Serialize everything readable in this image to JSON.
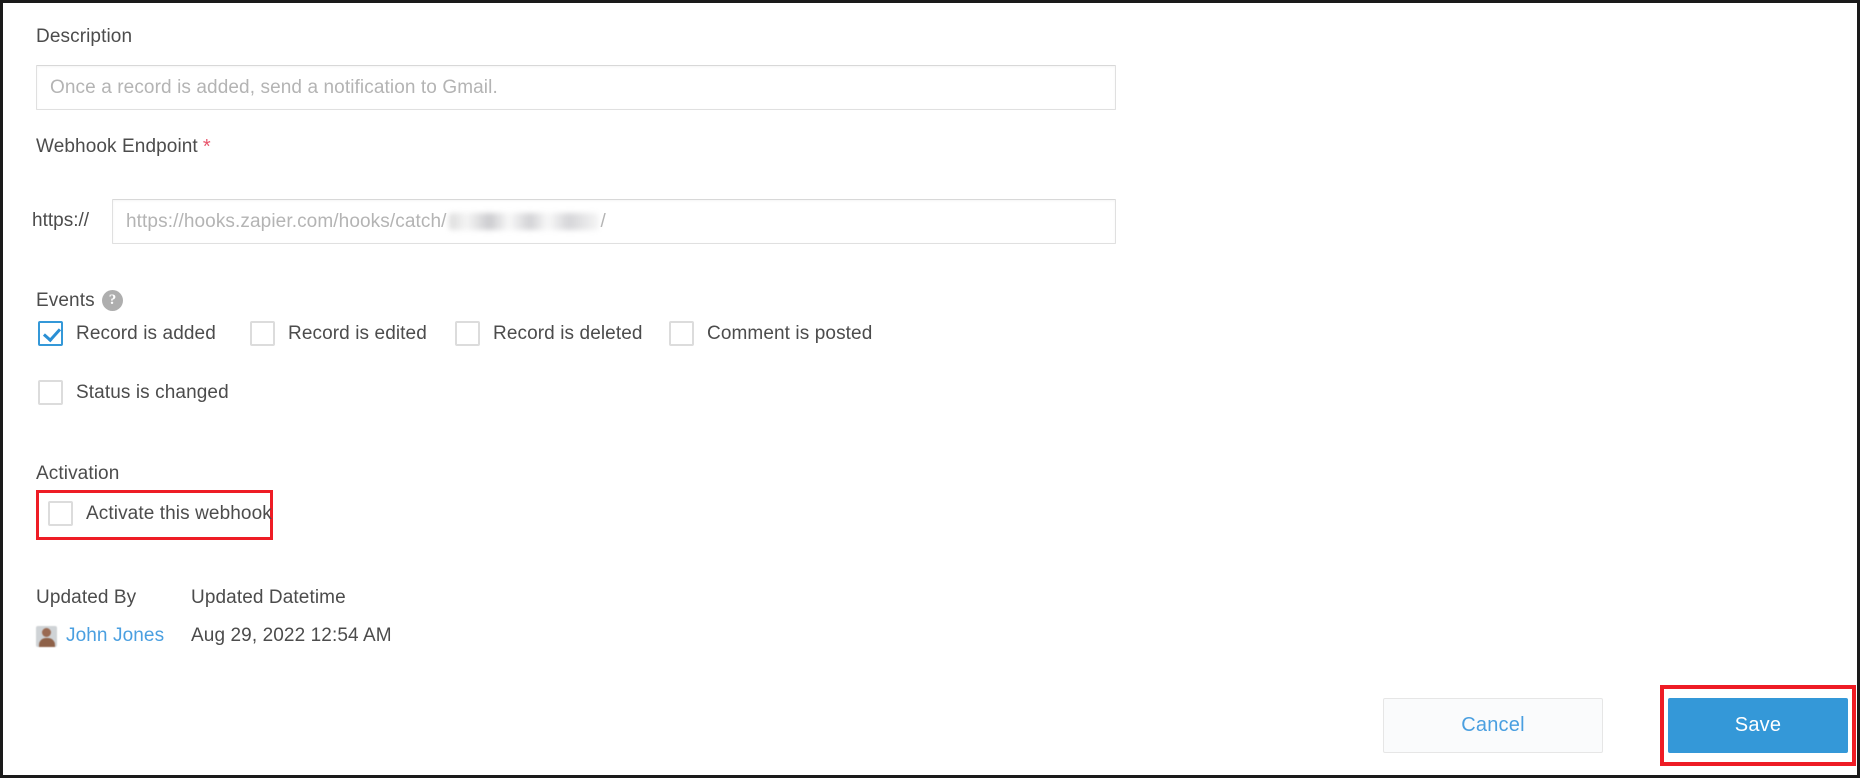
{
  "form": {
    "description": {
      "label": "Description",
      "value": "",
      "placeholder": "Once a record is added, send a notification to Gmail."
    },
    "webhook_endpoint": {
      "label": "Webhook Endpoint",
      "required_marker": "*",
      "prefix": "https://",
      "value": "",
      "placeholder_prefix": "https://hooks.zapier.com/hooks/catch/",
      "placeholder_suffix": "/"
    },
    "events": {
      "label": "Events",
      "help_icon": "question-mark-icon",
      "help_glyph": "?",
      "options": [
        {
          "label": "Record is added",
          "checked": true
        },
        {
          "label": "Record is edited",
          "checked": false
        },
        {
          "label": "Record is deleted",
          "checked": false
        },
        {
          "label": "Comment is posted",
          "checked": false
        },
        {
          "label": "Status is changed",
          "checked": false
        }
      ]
    },
    "activation": {
      "label": "Activation",
      "checkbox_label": "Activate this webhook",
      "checked": false,
      "highlighted": true
    },
    "metadata": {
      "headers": [
        "Updated By",
        "Updated Datetime"
      ],
      "updated_by": "John Jones",
      "updated_datetime": "Aug 29, 2022 12:54 AM",
      "avatar": "user-avatar"
    }
  },
  "footer": {
    "cancel_label": "Cancel",
    "save_label": "Save",
    "save_highlighted": true
  },
  "colors": {
    "accent_blue": "#3498d8",
    "link_blue": "#4a9fe0",
    "highlight_red": "#ee1c25",
    "required_red": "#e8546b",
    "text_gray": "#4c4c4c",
    "placeholder_gray": "#b4b4b4",
    "border_gray": "#e0e0e0"
  }
}
